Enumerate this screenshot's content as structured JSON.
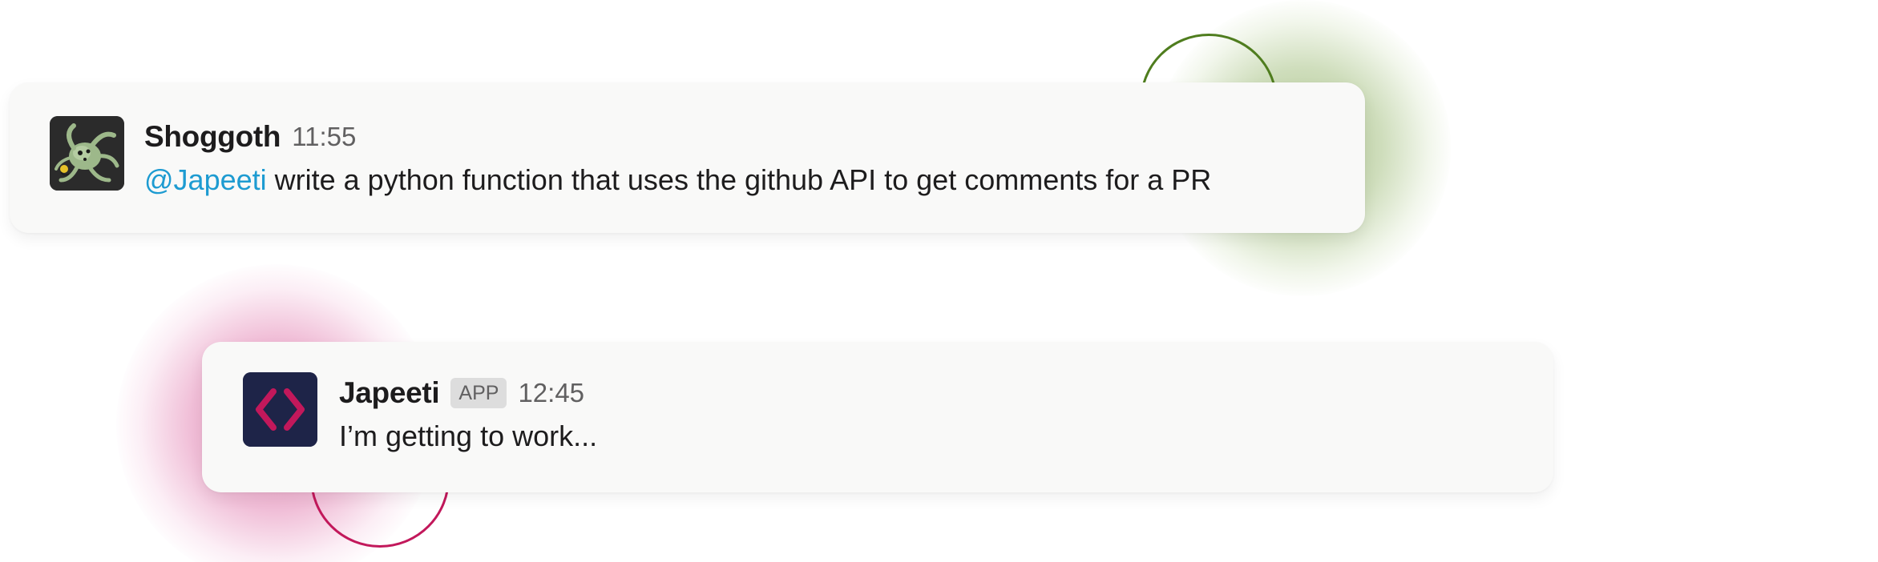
{
  "messages": [
    {
      "author": "Shoggoth",
      "time": "11:55",
      "mention": "@Japeeti",
      "text": " write a python function that uses the github API to get comments for a PR",
      "avatar_icon": "shoggoth-creature-icon"
    },
    {
      "author": "Japeeti",
      "badge": "APP",
      "time": "12:45",
      "text": "I’m getting to work...",
      "avatar_icon": "code-brackets-icon"
    }
  ],
  "colors": {
    "mention": "#1d9bd1",
    "green_accent": "#4f7d1e",
    "pink_accent": "#c2185b",
    "japeeti_avatar_bg": "#1e2448",
    "japeeti_brackets": "#c2185b"
  }
}
